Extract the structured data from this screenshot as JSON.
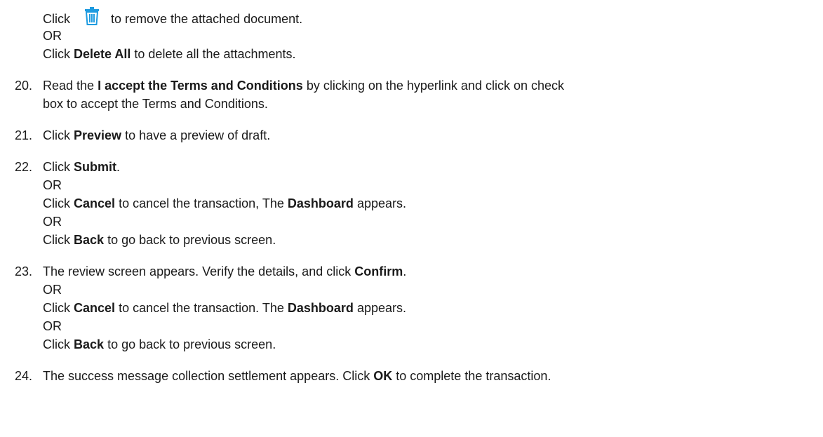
{
  "intro": {
    "click": "Click",
    "remove_text": "to remove the attached document.",
    "or1": "OR",
    "click2": "Click",
    "delete_all": "Delete All",
    "delete_all_text": "to delete all the attachments."
  },
  "step20": {
    "num": "20.",
    "a": "Read the",
    "b": "I accept the Terms and Conditions",
    "c": "by clicking on the hyperlink and click on check",
    "line2": "box to accept the Terms and Conditions."
  },
  "step21": {
    "num": "21.",
    "a": "Click",
    "b": "Preview",
    "c": "to have a preview of draft."
  },
  "step22": {
    "num": "22.",
    "a": "Click",
    "b": "Submit",
    "c": ".",
    "or1": "OR",
    "l3a": "Click",
    "l3b": "Cancel",
    "l3c": "to cancel the transaction, The",
    "l3d": "Dashboard",
    "l3e": "appears.",
    "or2": "OR",
    "l5a": "Click",
    "l5b": "Back",
    "l5c": "to go back to previous screen."
  },
  "step23": {
    "num": "23.",
    "a": "The review screen appears. Verify the details, and click",
    "b": "Confirm",
    "c": ".",
    "or1": "OR",
    "l3a": "Click",
    "l3b": "Cancel",
    "l3c": "to cancel the transaction. The",
    "l3d": "Dashboard",
    "l3e": "appears.",
    "or2": "OR",
    "l5a": "Click",
    "l5b": "Back",
    "l5c": "to go back to previous screen."
  },
  "step24": {
    "num": "24.",
    "a": "The success message collection settlement appears. Click",
    "b": "OK",
    "c": "to complete the transaction."
  },
  "icons": {
    "trash": "trash-icon",
    "color": "#1e9be0"
  }
}
